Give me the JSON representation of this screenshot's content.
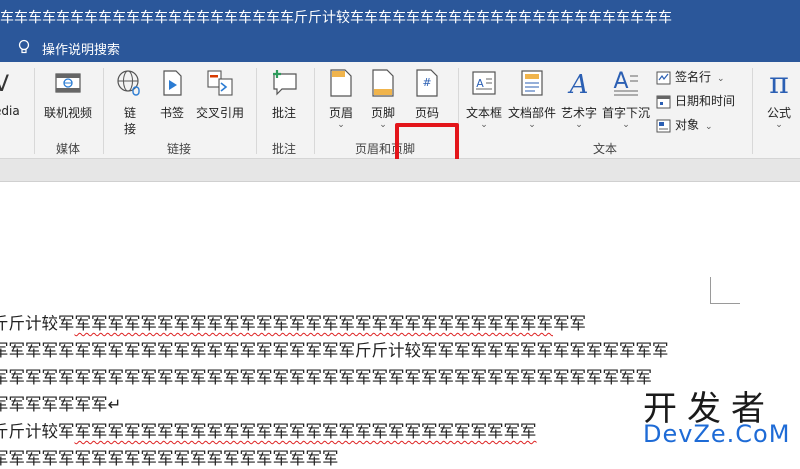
{
  "titlebar": {
    "text": "车车车车车车车车车车车车车车车车车车车车车斤斤计较车车车车车车车车车车车车车车车车车车车车车车车"
  },
  "tellme": {
    "label": "操作说明搜索"
  },
  "ribbon": {
    "partial_left": {
      "line1": "V",
      "line2": "edia"
    },
    "media": {
      "online_video": "联机视频",
      "group": "媒体"
    },
    "links": {
      "link_line1": "链",
      "link_line2": "接",
      "bookmark": "书签",
      "crossref": "交叉引用",
      "group": "链接"
    },
    "comments": {
      "comment": "批注",
      "group": "批注"
    },
    "header_footer": {
      "header": "页眉",
      "footer": "页脚",
      "page_number": "页码",
      "group": "页眉和页脚"
    },
    "text": {
      "textbox": "文本框",
      "quickparts": "文档部件",
      "wordart": "艺术字",
      "dropcap": "首字下沉",
      "signature": "签名行",
      "datetime": "日期和时间",
      "object": "对象",
      "group": "文本"
    },
    "equation": {
      "glyph": "π",
      "label": "公式"
    }
  },
  "document": {
    "lines": [
      {
        "pre": "斤斤计较军",
        "mid": "军军军军军军军军军军军军军军军军军军军军军军军军军军军军军",
        "post": "军军"
      },
      {
        "pre": "",
        "mid": "",
        "post": "军军军军军军军军军军军军军军军军军军军军军军斤斤计较军军军军军军军军军军军军军军军"
      },
      {
        "pre": "",
        "mid": "",
        "post": "军军军军军军军军军军军军军军军军军军军军军军军军军军军军军军军军军军军军军军军军"
      },
      {
        "pre": "",
        "mid": "",
        "post": "军军军军军军军↵"
      },
      {
        "pre": "斤斤计较军",
        "mid": "军军军军军军军军军军军军军军军军军军军军军军军军军军军军",
        "post": ""
      },
      {
        "pre": "",
        "mid": "",
        "post": "军军军军军军军军军军军军军军军军军军军军军"
      }
    ]
  },
  "watermark": {
    "cn": "开发者",
    "en": "DevZe.CoM"
  },
  "colors": {
    "titlebar": "#2b579a",
    "highlight": "#e3151a",
    "watermark_en": "#1e6bd6"
  }
}
